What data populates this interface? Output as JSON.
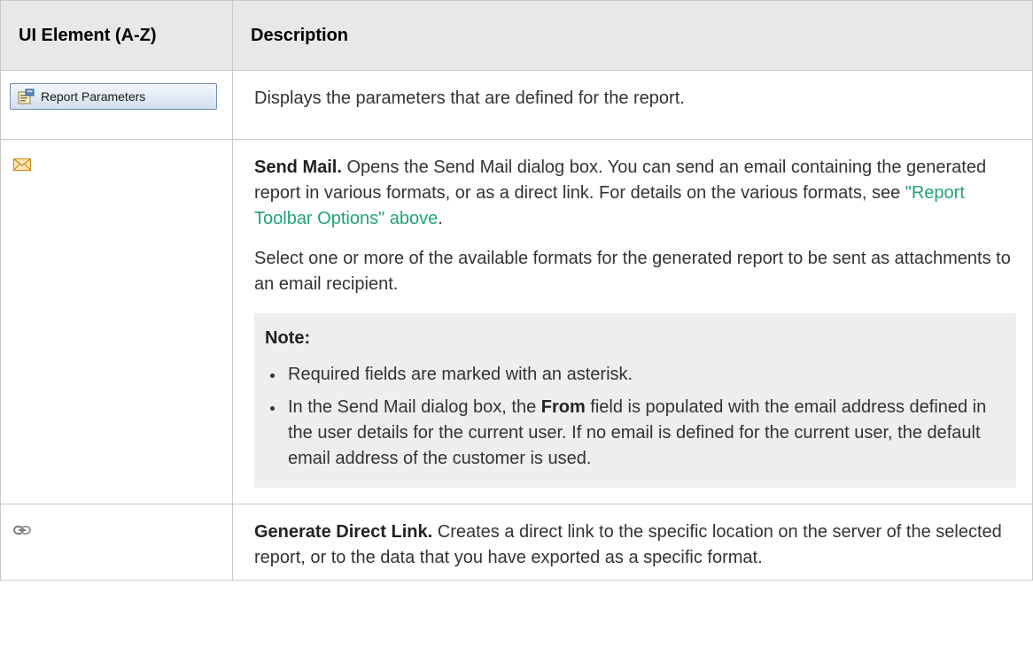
{
  "table": {
    "header": {
      "col1": "UI Element (A-Z)",
      "col2": "Description"
    },
    "rows": [
      {
        "element": {
          "type": "button",
          "label": "Report Parameters",
          "icon": "report-parameters-icon"
        },
        "description": "Displays the parameters that are defined for the report."
      },
      {
        "element": {
          "type": "icon",
          "icon": "mail-envelope-icon"
        },
        "title": "Send Mail.",
        "text1": " Opens the Send Mail dialog box. You can send an email containing the generated report in various formats, or as a direct link. For details on the various formats, see ",
        "link": "\"Report Toolbar Options\" above",
        "text1_end": ".",
        "para2": "Select one or more of the available formats for the generated report to be sent as attachments to an email recipient.",
        "note": {
          "title": "Note:",
          "item1": "Required fields are marked with an asterisk.",
          "item2_pre": "In the Send Mail dialog box, the ",
          "item2_bold": "From",
          "item2_post": " field is populated with the email address defined in the user details for the current user. If no email is defined for the current user, the default email address of the customer is used."
        }
      },
      {
        "element": {
          "type": "icon",
          "icon": "chain-link-icon"
        },
        "title": "Generate Direct Link.",
        "text": " Creates a direct link to the specific location on the server of the selected report, or to the data that you have exported as a specific format."
      }
    ]
  },
  "colors": {
    "link": "#1fa37a",
    "header_bg": "#e8e8e8",
    "note_bg": "#eeeeee",
    "border": "#c8c8c8"
  }
}
